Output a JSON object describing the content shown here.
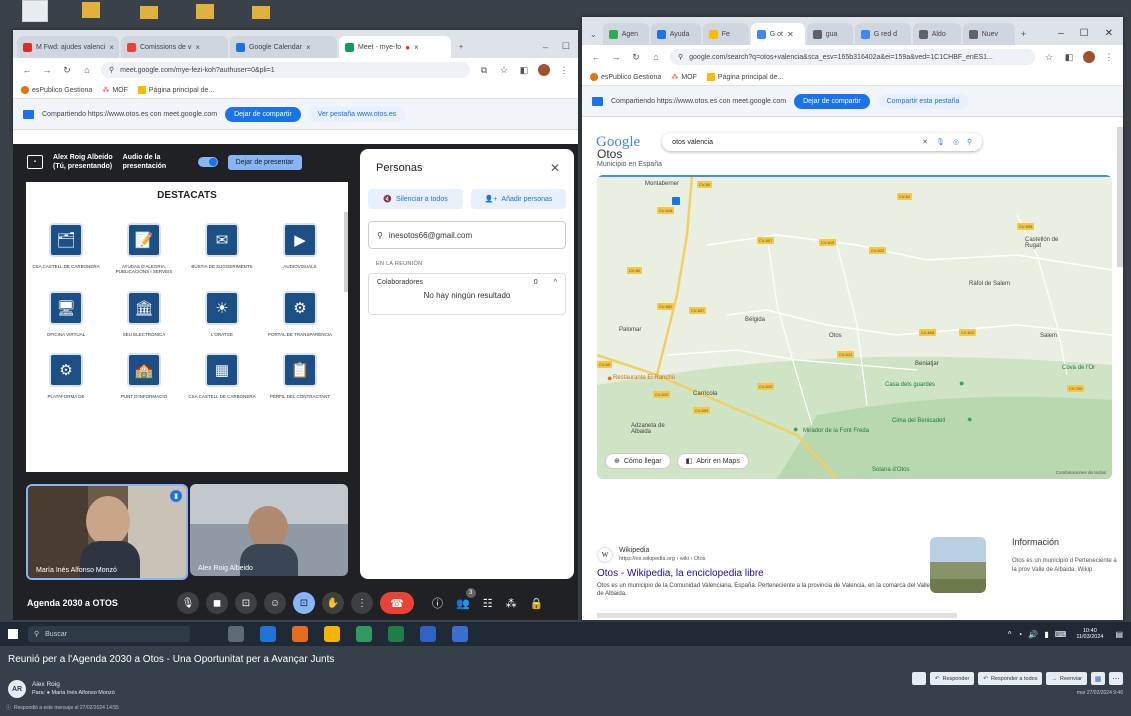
{
  "desktop": {
    "bg": "#3a4148"
  },
  "left_browser": {
    "tabs": [
      {
        "label": "M  Fwd: ajudes valenci",
        "color": "#d93025"
      },
      {
        "label": "Comissions de v",
        "color": "#ea4335"
      },
      {
        "label": "Google Calendar",
        "color": "#1a73e8"
      },
      {
        "label": "Meet - mye-fo",
        "color": "#0f9d58"
      }
    ],
    "tab_close": "×",
    "new_tab": "+",
    "url": "meet.google.com/mye-fezi-koh?authuser=0&pli=1",
    "bookmarks": [
      "esPublico Gestiona",
      "MOF",
      "Página principal de..."
    ],
    "share_text": "Compartiendo https://www.otos.es con meet.google.com",
    "stop_share": "Dejar de compartir",
    "see_tab": "Ver pestaña www.otos.es"
  },
  "meet": {
    "presenter_name": "Alex Roig Albeido",
    "presenter_sub": "(Tú, presentando)",
    "audio_label": "Audio de la presentación",
    "stop_present": "Dejar de presentar",
    "slide_title": "DESTACATS",
    "tiles": [
      {
        "label": "CSA CASTELL DE CARBONERA",
        "icon": "🗂"
      },
      {
        "label": "AYUDAS D'ALEGRIA, PUBLICACIONS I SERVEIS",
        "icon": "📝"
      },
      {
        "label": "BÚSTIA DE SUGGERIMENTS",
        "icon": "✉"
      },
      {
        "label": "AUDIOVISUALS",
        "icon": "▶"
      },
      {
        "label": "OFICINA VIRTUAL",
        "icon": "🖥"
      },
      {
        "label": "SEU ELECTRÒNICA",
        "icon": "🏛"
      },
      {
        "label": "L'ORATGE",
        "icon": "☀"
      },
      {
        "label": "PORTAL DE TRANSPARÈNCIA",
        "icon": "⚙"
      },
      {
        "label": "PLATAFORMA DE",
        "icon": "⚙"
      },
      {
        "label": "PUNT D'INFORMACIÓ",
        "icon": "🏫"
      },
      {
        "label": "CSA CASTELL DE CARBONERA",
        "icon": "▦"
      },
      {
        "label": "PERFIL DEL CONTRACTANT",
        "icon": "📋"
      }
    ],
    "participants": [
      {
        "name": "María Inés Alfonso Monzó"
      },
      {
        "name": "Alex Roig Albeido"
      }
    ],
    "meeting_title": "Agenda 2030 a OTOS",
    "people_count": "3"
  },
  "people_panel": {
    "title": "Personas",
    "mute_all": "Silenciar a todos",
    "add_people": "Añadir personas",
    "search_value": "inesotos66@gmail.com",
    "in_meeting": "EN LA REUNIÓN",
    "collab_label": "Colaboradores",
    "collab_count": "0",
    "no_results": "No hay ningún resultado"
  },
  "right_browser": {
    "tabs": [
      {
        "label": "Agen",
        "color": "#34a853"
      },
      {
        "label": "Ayuda",
        "color": "#1a73e8"
      },
      {
        "label": "Fe",
        "color": "#fbbc04"
      },
      {
        "label": "G ot",
        "color": "#4285f4"
      },
      {
        "label": "gua",
        "color": "#5f6368"
      },
      {
        "label": "G red d",
        "color": "#4285f4"
      },
      {
        "label": "Aldo",
        "color": "#5f6368"
      },
      {
        "label": "Nuev",
        "color": "#5f6368"
      }
    ],
    "url": "google.com/search?q=otos+valencia&sca_esv=165b316402a&ei=159a&ved=1C1CHBF_enES1...",
    "bookmarks": [
      "esPublico Gestiona",
      "MOF",
      "Página principal de..."
    ],
    "share_text": "Compartiendo https://www.otos.es con meet.google.com",
    "stop_share": "Dejar de compartir",
    "share_tab": "Compartir esta pestaña"
  },
  "google": {
    "logo": "Google",
    "query": "otos valencia",
    "heading": "Otos",
    "subheading": "Municipio en España",
    "map_labels": [
      "Montaberner",
      "Castellón de Rugat",
      "Ràfol de Salem",
      "Bèlgida",
      "Palomar",
      "Otos",
      "Salem",
      "Beniatjar",
      "Carrícola",
      "Casa dels guardes",
      "Cova de l'Or",
      "Adzaneta de Albaida",
      "Cima del Benicadell",
      "Mirador de la Font Freda",
      "Restaurante El Rancho",
      "Solana d'Otos"
    ],
    "how_to_get": "Cómo llegar",
    "open_maps": "Abrir en Maps",
    "map_footer": "Combinaciones de teclas",
    "wiki_site": "Wikipedia",
    "wiki_url": "https://es.wikipedia.org › wiki › Otos",
    "wiki_title": "Otos - Wikipedia, la enciclopedia libre",
    "wiki_snippet": "Otos es un municipio de la Comunidad Valenciana, España. Perteneciente a la provincia de Valencia, en la comarca del Valle de Albaida.",
    "info_title": "Información",
    "info_text": "Otos es un municipio d Perteneciente a la prov Valle de Albaida. Wikip"
  },
  "taskbar": {
    "search": "Buscar",
    "time": "10:40",
    "date": "11/03/2024"
  },
  "email": {
    "subject": "Reunió per a l'Agenda 2030 a Otos - Una Oportunitat per a Avançar Junts",
    "avatar": "AR",
    "sender": "Alex Roig",
    "to": "Para: ● Maria Inés Alfonso Monzó",
    "note": "Respondió a este mensaje el 27/02/2024 14:55",
    "reply": "Responder",
    "reply_all": "Responder a todos",
    "forward": "Reenviar",
    "date": "mar 27/02/2024 9:46"
  }
}
